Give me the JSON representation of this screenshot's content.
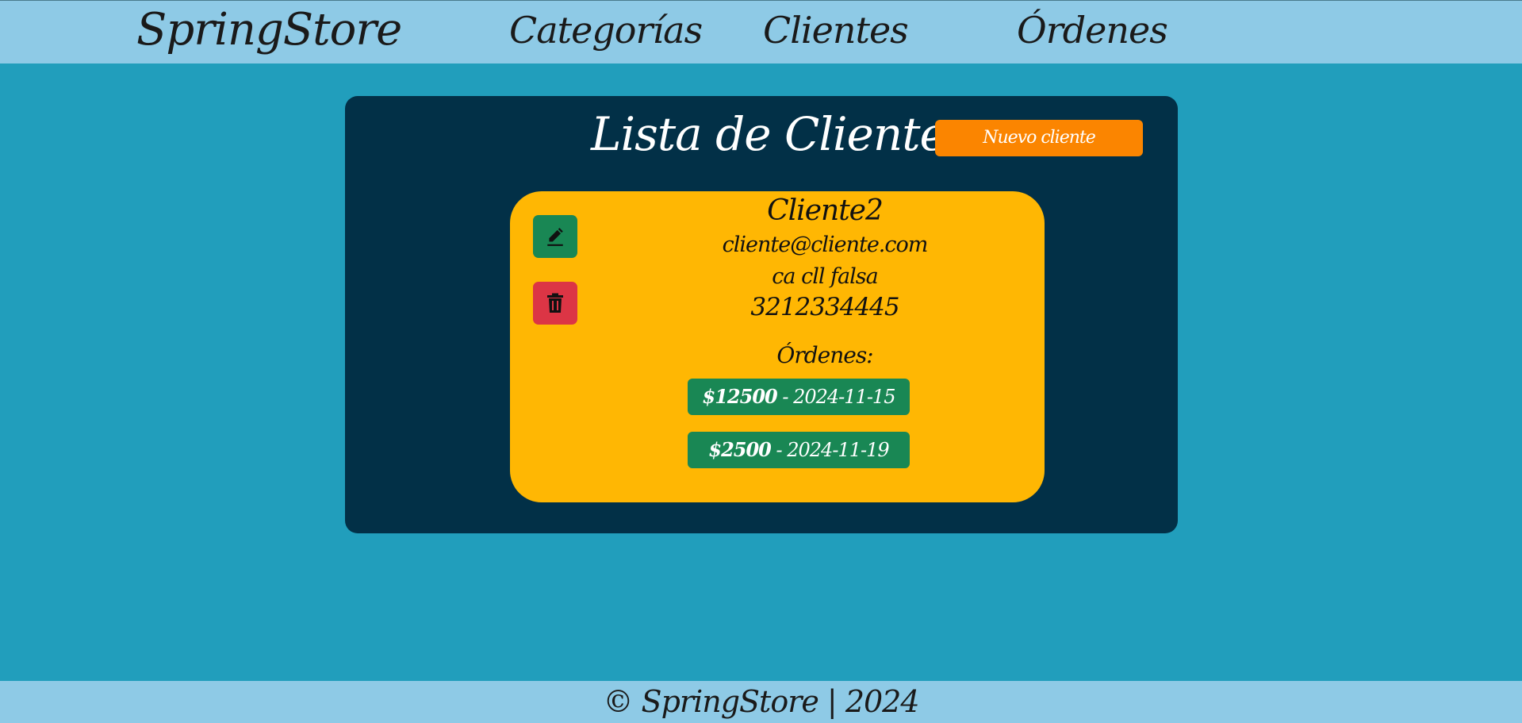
{
  "navbar": {
    "brand": "SpringStore",
    "links": [
      "Categorías",
      "Clientes",
      "Órdenes"
    ]
  },
  "main": {
    "title": "Lista de Clientes",
    "new_button_label": "Nuevo cliente",
    "client": {
      "name": "Cliente2",
      "email": "cliente@cliente.com",
      "address": "ca cll falsa",
      "phone": "3212334445",
      "orders_label": "Órdenes:",
      "orders": [
        {
          "amount": "$12500",
          "date": " - 2024-11-15"
        },
        {
          "amount": "$2500",
          "date": " - 2024-11-19"
        }
      ],
      "edit_icon": "pencil-icon",
      "delete_icon": "trash-icon"
    }
  },
  "footer": {
    "text": "© SpringStore | 2024"
  },
  "colors": {
    "navbar_bg": "#8ecae6",
    "page_bg": "#219ebc",
    "card_bg": "#023047",
    "client_card_bg": "#ffb703",
    "primary_button": "#fb8500",
    "success": "#198754",
    "danger": "#dc3545"
  }
}
